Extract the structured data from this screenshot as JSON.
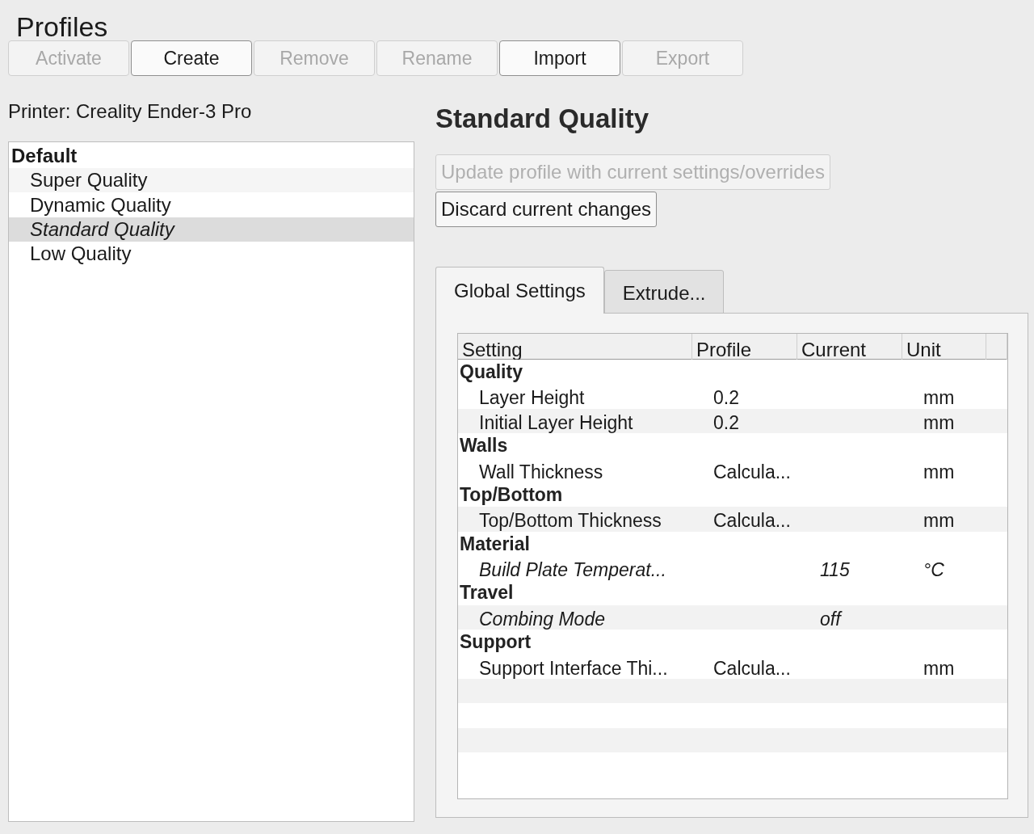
{
  "title": "Profiles",
  "toolbar": [
    {
      "label": "Activate",
      "disabled": true
    },
    {
      "label": "Create",
      "disabled": false
    },
    {
      "label": "Remove",
      "disabled": true
    },
    {
      "label": "Rename",
      "disabled": true
    },
    {
      "label": "Import",
      "disabled": false
    },
    {
      "label": "Export",
      "disabled": true
    }
  ],
  "printer_label": "Printer: Creality Ender-3 Pro",
  "profile_list": {
    "group": "Default",
    "items": [
      {
        "label": "Super Quality",
        "selected": false
      },
      {
        "label": "Dynamic Quality",
        "selected": false
      },
      {
        "label": "Standard Quality",
        "selected": true
      },
      {
        "label": "Low Quality",
        "selected": false
      }
    ]
  },
  "detail": {
    "title": "Standard Quality",
    "actions": [
      {
        "label": "Update profile with current settings/overrides",
        "disabled": true
      },
      {
        "label": "Discard current changes",
        "disabled": false
      }
    ],
    "tabs": [
      {
        "label": "Global Settings",
        "selected": true
      },
      {
        "label": "Extrude...",
        "selected": false
      }
    ],
    "table": {
      "columns": [
        "Setting",
        "Profile",
        "Current",
        "Unit"
      ],
      "groups": [
        {
          "name": "Quality",
          "children": [
            {
              "setting": "Layer Height",
              "profile": "0.2",
              "unit": "mm",
              "overridden": false
            },
            {
              "setting": "Initial Layer Height",
              "profile": "0.2",
              "unit": "mm",
              "overridden": false
            }
          ]
        },
        {
          "name": "Walls",
          "children": [
            {
              "setting": "Wall Thickness",
              "profile": "Calcula...",
              "unit": "mm",
              "overridden": false
            }
          ]
        },
        {
          "name": "Top/Bottom",
          "children": [
            {
              "setting": "Top/Bottom Thickness",
              "profile": "Calcula...",
              "unit": "mm",
              "overridden": false
            }
          ]
        },
        {
          "name": "Material",
          "children": [
            {
              "setting": "Build Plate Temperat...",
              "current": "115",
              "unit": "°C",
              "overridden": true
            }
          ]
        },
        {
          "name": "Travel",
          "children": [
            {
              "setting": "Combing Mode",
              "current": "off",
              "overridden": true
            }
          ]
        },
        {
          "name": "Support",
          "children": [
            {
              "setting": "Support Interface Thi...",
              "profile": "Calcula...",
              "unit": "mm",
              "overridden": false
            }
          ]
        }
      ]
    }
  }
}
